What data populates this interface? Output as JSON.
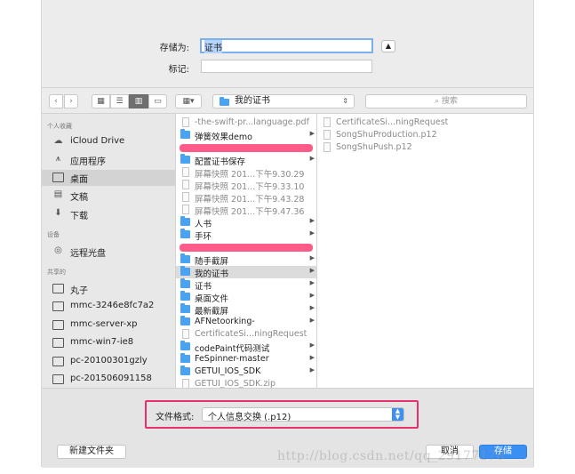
{
  "save": {
    "save_as_label": "存储为:",
    "save_as_value": "证书",
    "tags_label": "标记:",
    "tags_value": ""
  },
  "toolbar": {
    "back": "‹",
    "forward": "›",
    "location": "我的证书",
    "search_placeholder": "搜索"
  },
  "sidebar": {
    "sections": [
      {
        "title": "个人收藏",
        "items": [
          "iCloud Drive",
          "应用程序",
          "桌面",
          "文稿",
          "下载"
        ]
      },
      {
        "title": "设备",
        "items": [
          "远程光盘"
        ]
      },
      {
        "title": "共享的",
        "items": [
          "丸子",
          "mmc-3246e8fc7a2",
          "mmc-server-xp",
          "mmc-win7-ie8",
          "pc-20100301gzly",
          "pc-201506091158"
        ]
      }
    ],
    "icons": {
      "iCloud Drive": "cloud-icon",
      "应用程序": "apps-icon",
      "桌面": "desktop-icon",
      "文稿": "document-icon",
      "下载": "download-icon",
      "远程光盘": "disc-icon"
    }
  },
  "column1": [
    {
      "name": "-the-swift-pr...language.pdf",
      "type": "file"
    },
    {
      "name": "弹簧效果demo",
      "type": "folder"
    },
    {
      "name": "",
      "type": "redacted"
    },
    {
      "name": "配置证书保存",
      "type": "folder"
    },
    {
      "name": "屏幕快照 201...下午9.30.29",
      "type": "file"
    },
    {
      "name": "屏幕快照 201...下午9.33.10",
      "type": "file"
    },
    {
      "name": "屏幕快照 201...下午9.43.28",
      "type": "file"
    },
    {
      "name": "屏幕快照 201...下午9.47.36",
      "type": "file"
    },
    {
      "name": "人书",
      "type": "folder"
    },
    {
      "name": "手环",
      "type": "folder"
    },
    {
      "name": "",
      "type": "redacted"
    },
    {
      "name": "随手截屏",
      "type": "folder"
    },
    {
      "name": "我的证书",
      "type": "folder",
      "selected": true
    },
    {
      "name": "证书",
      "type": "folder"
    },
    {
      "name": "桌面文件",
      "type": "folder"
    },
    {
      "name": "最新截屏",
      "type": "folder"
    },
    {
      "name": "AFNetoorking-",
      "type": "folder"
    },
    {
      "name": "CertificateSi...ningRequest",
      "type": "file"
    },
    {
      "name": "codePaint代码测试",
      "type": "folder"
    },
    {
      "name": "FeSpinner-master",
      "type": "folder"
    },
    {
      "name": "GETUI_IOS_SDK",
      "type": "folder"
    },
    {
      "name": "GETUI_IOS_SDK.zip",
      "type": "file"
    }
  ],
  "column2": [
    {
      "name": "CertificateSi...ningRequest"
    },
    {
      "name": "SongShuProduction.p12"
    },
    {
      "name": "SongShuPush.p12"
    }
  ],
  "format": {
    "label": "文件格式:",
    "value": "个人信息交换 (.p12)"
  },
  "buttons": {
    "new_folder": "新建文件夹",
    "cancel": "取消",
    "save": "存储"
  },
  "watermark": "http://blog.csdn.net/qq_29177170",
  "colors": {
    "accent": "#3a8ff3",
    "folder": "#49a3f2",
    "highlight_box": "#e8306a",
    "redaction": "#ff4076"
  }
}
